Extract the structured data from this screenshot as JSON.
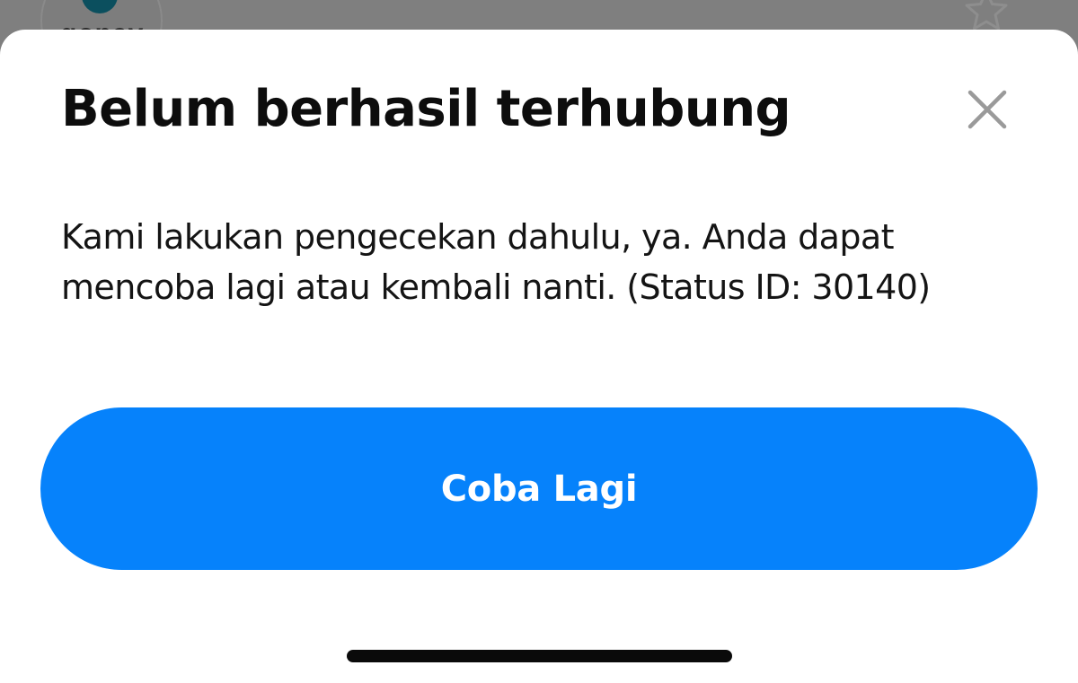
{
  "background_app": {
    "logo_text": "gopay",
    "favorite_icon": "star-outline-icon"
  },
  "dialog": {
    "title": "Belum berhasil terhubung",
    "close_icon": "close-icon",
    "message": "Kami lakukan pengecekan dahulu, ya. Anda dapat mencoba lagi atau kembali nanti. (Status ID: 30140)",
    "retry_label": "Coba Lagi"
  },
  "colors": {
    "primary": "#0682fb",
    "overlay": "#7f7f7f",
    "sheet": "#ffffff",
    "text": "#0d0d0d",
    "close_icon": "#9a9a9a"
  }
}
